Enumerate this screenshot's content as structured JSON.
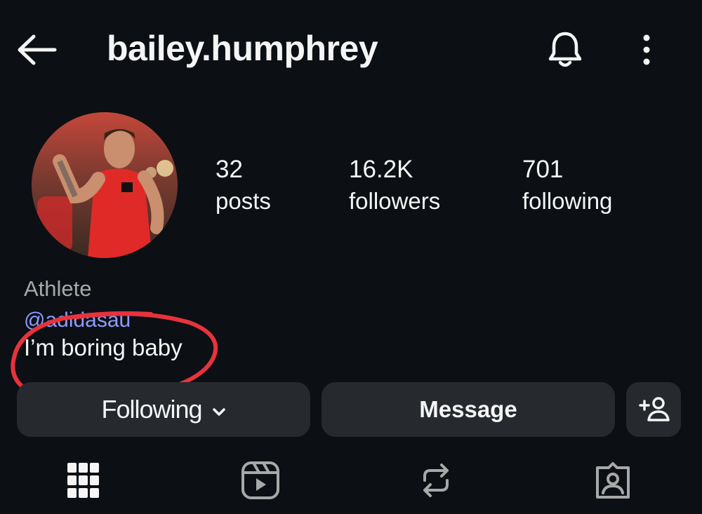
{
  "header": {
    "username": "bailey.humphrey",
    "icons": [
      "back-arrow-icon",
      "bell-icon",
      "more-vertical-icon"
    ]
  },
  "profile": {
    "stats": [
      {
        "value": "32",
        "label": "posts"
      },
      {
        "value": "16.2K",
        "label": "followers"
      },
      {
        "value": "701",
        "label": "following"
      }
    ],
    "category": "Athlete",
    "mention": "@adidasau",
    "bio": "I’m boring baby",
    "annotation_color": "#e8323c"
  },
  "actions": {
    "following_label": "Following",
    "message_label": "Message",
    "add_icon": "add-person-icon"
  },
  "tabs": [
    "grid-icon",
    "reels-icon",
    "reposts-icon",
    "tagged-icon"
  ],
  "colors": {
    "background": "#0c1014",
    "button": "#262a2e",
    "link": "#8f9bff",
    "muted": "#a8a8a8"
  }
}
